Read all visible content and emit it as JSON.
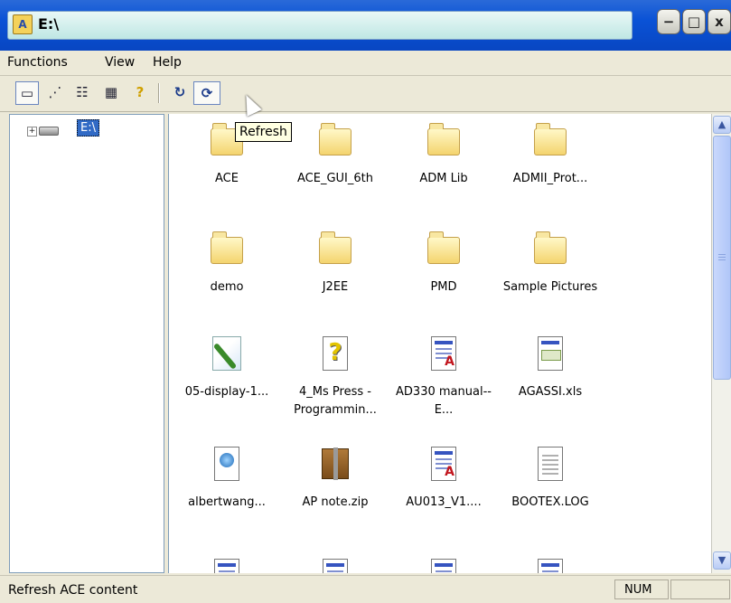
{
  "window": {
    "title": "E:\\",
    "app_icon_letter": "A",
    "controls": {
      "minimize": "−",
      "maximize": "□",
      "close": "x"
    }
  },
  "menu": [
    "Functions",
    "View",
    "Help"
  ],
  "toolbar": {
    "buttons": [
      {
        "icon": "large-icons-view-icon",
        "glyph": "▭",
        "pressed": true
      },
      {
        "icon": "small-icons-view-icon",
        "glyph": "⋰"
      },
      {
        "icon": "list-view-icon",
        "glyph": "☷"
      },
      {
        "icon": "details-view-icon",
        "glyph": "▦"
      },
      {
        "icon": "help-icon",
        "glyph": "?"
      },
      {
        "icon": "reload-icon",
        "glyph": "↻"
      },
      {
        "icon": "refresh-icon",
        "glyph": "⟳",
        "pressed": true
      }
    ],
    "tooltip": "Refresh"
  },
  "tree": {
    "expand_glyph": "+",
    "drive_label": "E:\\"
  },
  "files": [
    {
      "name": "ACE",
      "type": "folder"
    },
    {
      "name": "ACE_GUI_6th",
      "type": "folder"
    },
    {
      "name": "ADM Lib",
      "type": "folder"
    },
    {
      "name": "ADMII_Prot...",
      "type": "folder"
    },
    {
      "name": "demo",
      "type": "folder"
    },
    {
      "name": "J2EE",
      "type": "folder"
    },
    {
      "name": "PMD",
      "type": "folder"
    },
    {
      "name": "Sample Pictures",
      "type": "folder"
    },
    {
      "name": "05-display-1...",
      "type": "image"
    },
    {
      "name": "4_Ms Press - Programmin...",
      "type": "help"
    },
    {
      "name": "AD330 manual--E...",
      "type": "pdf"
    },
    {
      "name": "AGASSI.xls",
      "type": "xls"
    },
    {
      "name": "albertwang...",
      "type": "html"
    },
    {
      "name": "AP note.zip",
      "type": "zip"
    },
    {
      "name": "AU013_V1....",
      "type": "pdf"
    },
    {
      "name": "BOOTEX.LOG",
      "type": "text"
    },
    {
      "name": "",
      "type": "doc"
    },
    {
      "name": "",
      "type": "pdf"
    },
    {
      "name": "",
      "type": "pdf"
    },
    {
      "name": "",
      "type": "doc"
    }
  ],
  "scrollbar": {
    "up_glyph": "▲",
    "down_glyph": "▼",
    "position": 0.0
  },
  "status": {
    "text": "Refresh ACE content",
    "num": "NUM"
  }
}
